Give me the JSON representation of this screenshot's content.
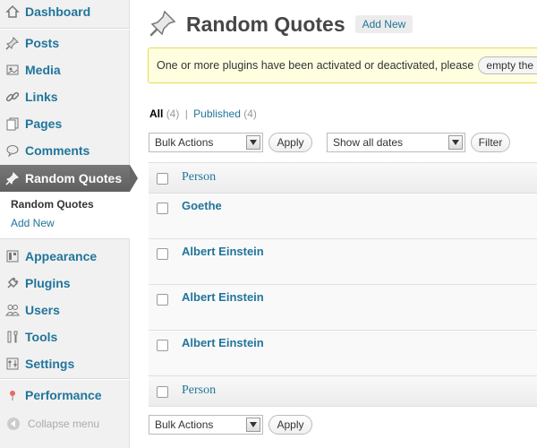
{
  "sidebar": {
    "dashboard": "Dashboard",
    "posts": "Posts",
    "media": "Media",
    "links": "Links",
    "pages": "Pages",
    "comments": "Comments",
    "random_quotes": "Random Quotes",
    "submenu": {
      "current": "Random Quotes",
      "add_new": "Add New"
    },
    "appearance": "Appearance",
    "plugins": "Plugins",
    "users": "Users",
    "tools": "Tools",
    "settings": "Settings",
    "performance": "Performance",
    "collapse": "Collapse menu"
  },
  "header": {
    "title": "Random Quotes",
    "add_new": "Add New"
  },
  "notice": {
    "text": "One or more plugins have been activated or deactivated, please",
    "button": "empty the page cache"
  },
  "filters": {
    "all_label": "All",
    "all_count": "(4)",
    "separator": "|",
    "published_label": "Published",
    "published_count": "(4)"
  },
  "top_actions": {
    "bulk": "Bulk Actions",
    "apply": "Apply",
    "dates": "Show all dates",
    "filter": "Filter"
  },
  "table": {
    "column_header": "Person",
    "rows": [
      "Goethe",
      "Albert Einstein",
      "Albert Einstein",
      "Albert Einstein"
    ],
    "column_footer": "Person"
  },
  "bottom_actions": {
    "bulk": "Bulk Actions",
    "apply": "Apply"
  },
  "colors": {
    "link": "#21759b",
    "active_menu": "#6d6d6d",
    "notice_bg": "#ffffe0",
    "notice_border": "#e6db55"
  }
}
